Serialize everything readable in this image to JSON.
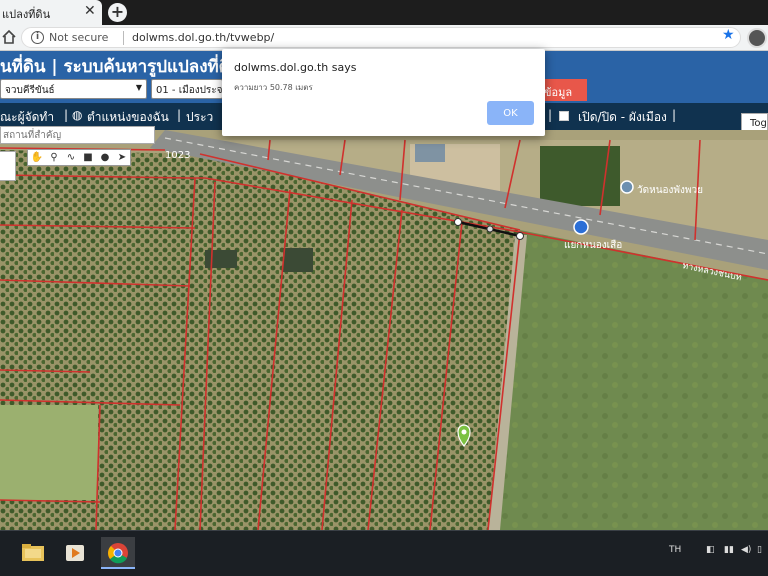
{
  "browser": {
    "tab_title": "แปลงที่ดิน",
    "tab_close": "✕",
    "new_tab": "+",
    "security_label": "Not secure",
    "url": "dolwms.dol.go.th/tvwebp/"
  },
  "site": {
    "title": "นที่ดิน | ระบบค้นหารูปแปลงที่ดิน",
    "province_select": "จวบคีรีขันธ์",
    "district_select": "01 - เมืองประจ",
    "search_button": "ข้อมูล"
  },
  "nav": {
    "items": [
      "ณะผู้จัดทำ",
      "|",
      "ตำแหน่งของฉัน",
      "|",
      "ประว",
      "|",
      "เปิด/ปิด - ผังเมือง",
      "|"
    ],
    "toggle_button": "Tog"
  },
  "map": {
    "place_search_placeholder": "สถานที่สำคัญ",
    "road_label": "1023",
    "poi_temple": "วัดหนองพังพวย",
    "poi_junction": "แยกหนองเสือ",
    "road_name": "ทางหลวงชนบท",
    "tools": [
      "✋",
      "⚲",
      "∿",
      "■",
      "●",
      "➤"
    ]
  },
  "dialog": {
    "title": "dolwms.dol.go.th says",
    "message": "ความยาว 50.78 เมตร",
    "ok_button": "OK"
  },
  "taskbar": {
    "language": "TH",
    "apps": [
      "file-explorer",
      "media-player",
      "chrome"
    ]
  },
  "colors": {
    "header_blue": "#2a63a6",
    "nav_dark": "#10324f",
    "parcel_line": "#d0312d",
    "dialog_ok": "#8ab4f8",
    "search_red": "#e8574a"
  }
}
